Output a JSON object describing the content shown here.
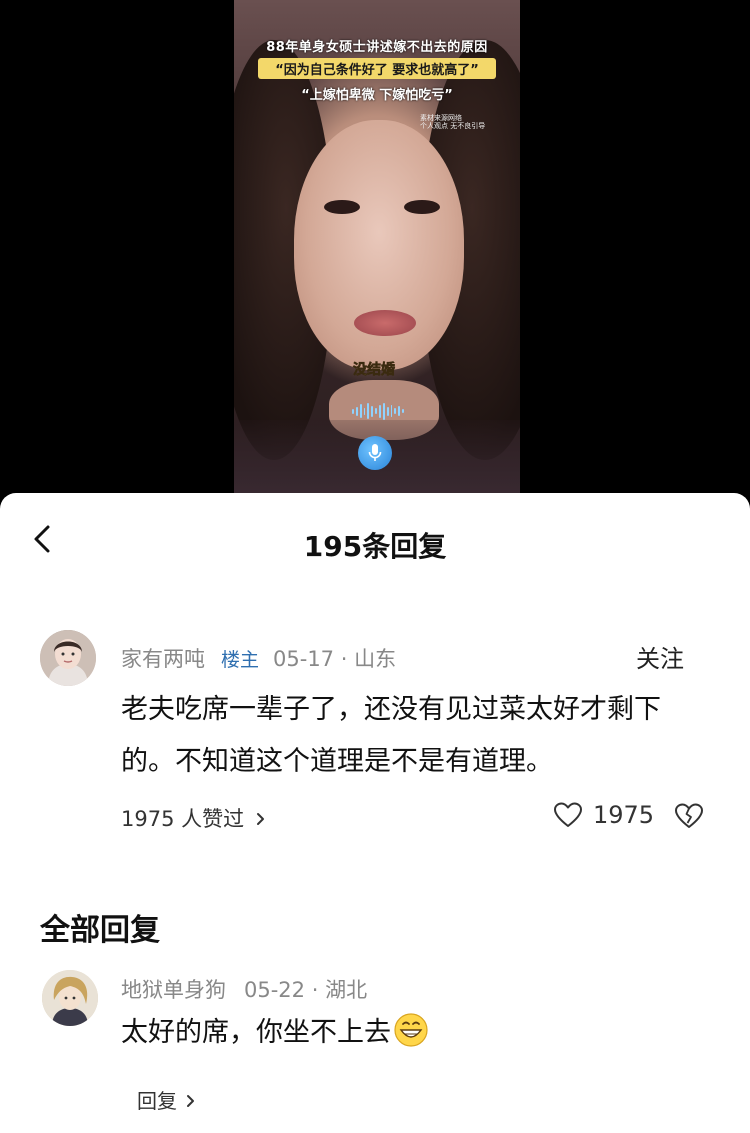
{
  "video": {
    "title": "88年单身女硕士讲述嫁不出去的原因",
    "quote1": "“因为自己条件好了 要求也就高了”",
    "quote2": "“上嫁怕卑微 下嫁怕吃亏”",
    "watermark_line1": "素材来源网络",
    "watermark_line2": "个人观点 无不良引导",
    "subtitle": "没结婚"
  },
  "header": {
    "title": "195条回复"
  },
  "main_comment": {
    "username": "家有两吨",
    "badge": "楼主",
    "date": "05-17",
    "separator": "·",
    "location": "山东",
    "follow_label": "关注",
    "text": "老夫吃席一辈子了，还没有见过菜太好才剩下的。不知道这个道理是不是有道理。",
    "likes_summary": "1975 人赞过",
    "like_count": "1975"
  },
  "replies_section": {
    "title": "全部回复"
  },
  "reply": {
    "username": "地狱单身狗",
    "date": "05-22",
    "separator": "·",
    "location": "湖北",
    "text": "太好的席，你坐不上去",
    "reply_label": "回复"
  },
  "icons": {
    "back": "chevron-left-icon",
    "mic": "microphone-icon",
    "like": "heart-outline-icon",
    "dislike": "broken-heart-icon",
    "chevron": "chevron-right-icon",
    "emoji": "grin-emoji-icon"
  }
}
